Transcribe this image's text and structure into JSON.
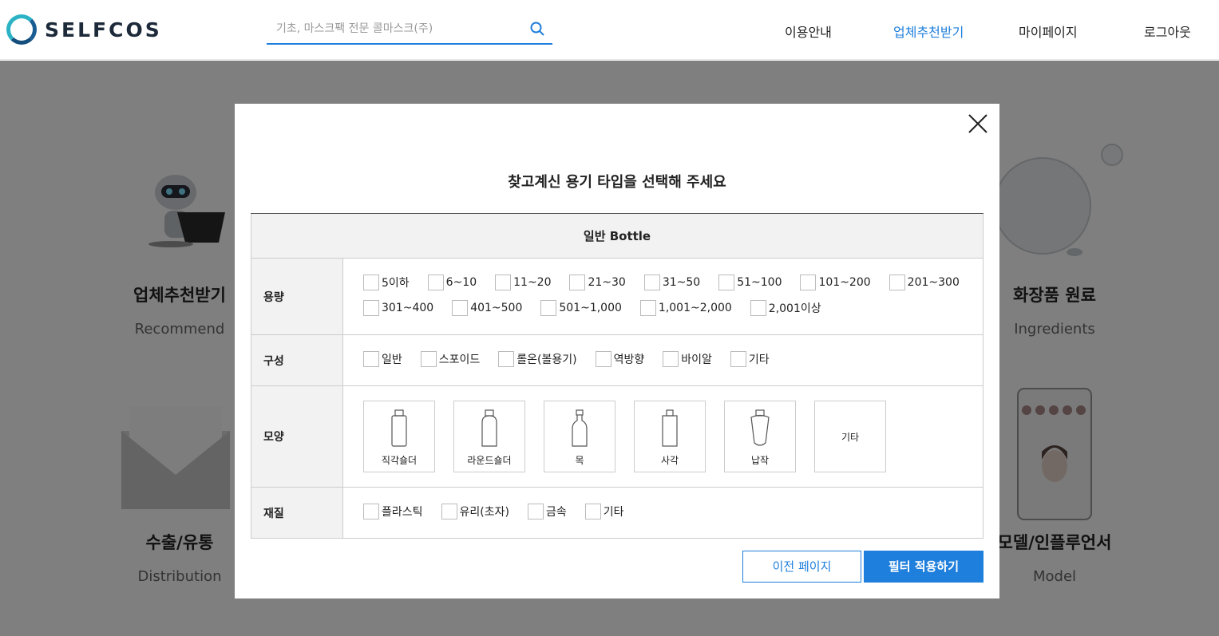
{
  "header": {
    "logo_text": "SELFCOS",
    "search_placeholder": "기초, 마스크팩 전문 콜마스크(주)",
    "nav": [
      "이용안내",
      "업체추천받기",
      "마이페이지",
      "로그아웃"
    ],
    "active_nav": "업체추천받기",
    "accent_color": "#1f7fdc"
  },
  "background_cards": [
    {
      "title": "업체추천받기",
      "sub": "Recommend"
    },
    {
      "title": "화장품 원료",
      "sub": "Ingredients"
    },
    {
      "title": "수출/유통",
      "sub": "Distribution"
    },
    {
      "title": "모델/인플루언서",
      "sub": "Model"
    }
  ],
  "modal": {
    "title": "찾고계신 용기 타입을 선택해 주세요",
    "table_head": "일반 Bottle",
    "rows": {
      "capacity": {
        "label": "용량",
        "options": [
          "5이하",
          "6~10",
          "11~20",
          "21~30",
          "31~50",
          "51~100",
          "101~200",
          "201~300",
          "301~400",
          "401~500",
          "501~1,000",
          "1,001~2,000",
          "2,001이상"
        ]
      },
      "composition": {
        "label": "구성",
        "options": [
          "일반",
          "스포이드",
          "롤온(볼용기)",
          "역방향",
          "바이알",
          "기타"
        ]
      },
      "shape": {
        "label": "모양",
        "options": [
          "직각숄더",
          "라운드숄더",
          "목",
          "사각",
          "납작",
          "기타"
        ]
      },
      "material": {
        "label": "재질",
        "options": [
          "플라스틱",
          "유리(초자)",
          "금속",
          "기타"
        ]
      }
    },
    "buttons": {
      "prev": "이전 페이지",
      "apply": "필터 적용하기"
    }
  }
}
